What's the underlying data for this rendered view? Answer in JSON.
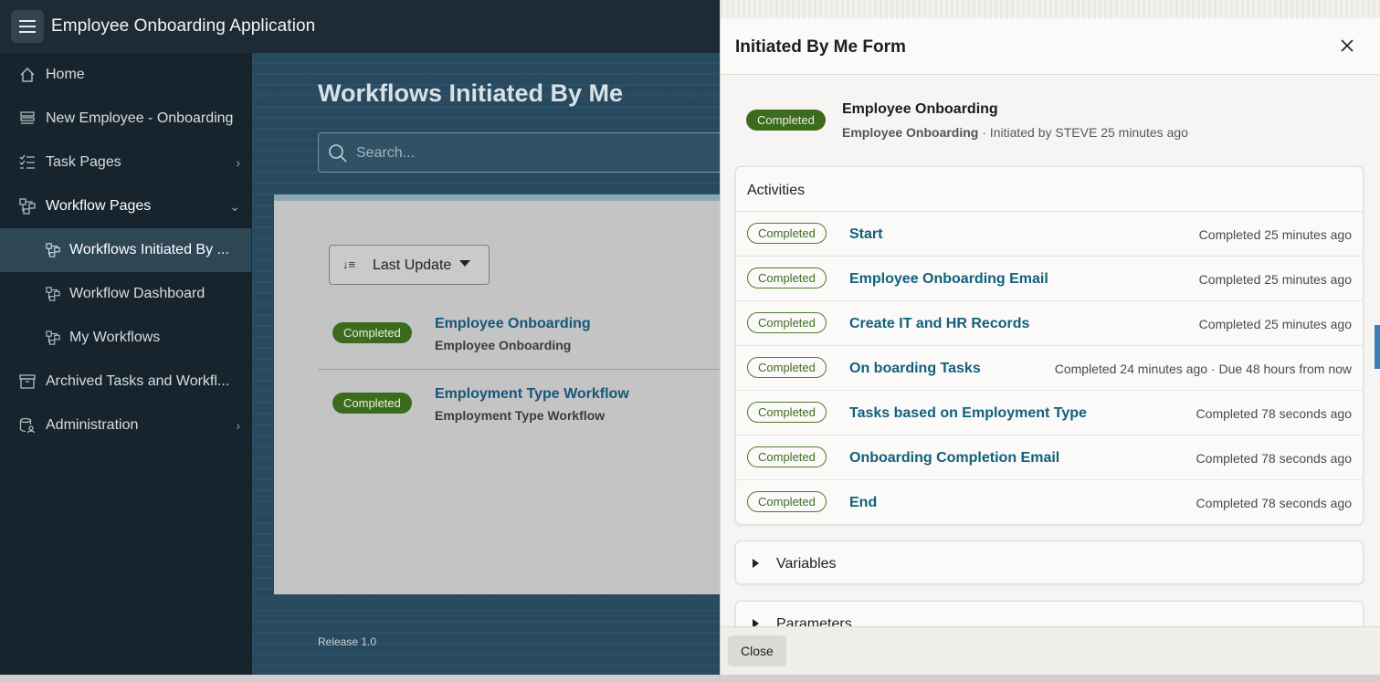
{
  "header": {
    "app_title": "Employee Onboarding Application"
  },
  "sidebar": {
    "items": [
      {
        "label": "Home",
        "icon": "home-icon"
      },
      {
        "label": "New Employee - Onboarding",
        "icon": "form-icon"
      },
      {
        "label": "Task Pages",
        "icon": "checklist-icon",
        "chevron": "›"
      },
      {
        "label": "Workflow Pages",
        "icon": "workflow-icon",
        "chevron": "⌄"
      },
      {
        "label": "Workflows Initiated By ...",
        "icon": "workflow-icon",
        "active": true
      },
      {
        "label": "Workflow Dashboard",
        "icon": "workflow-icon"
      },
      {
        "label": "My Workflows",
        "icon": "workflow-icon"
      },
      {
        "label": "Archived Tasks and Workfl...",
        "icon": "archive-icon"
      },
      {
        "label": "Administration",
        "icon": "admin-icon",
        "chevron": "›"
      }
    ]
  },
  "main": {
    "title": "Workflows Initiated By Me",
    "search_placeholder": "Search...",
    "sort_label": "Last Update",
    "workflows": [
      {
        "status": "Completed",
        "title": "Employee Onboarding",
        "subtitle": "Employee Onboarding"
      },
      {
        "status": "Completed",
        "title": "Employment Type Workflow",
        "subtitle": "Employment Type Workflow"
      }
    ],
    "release": "Release 1.0"
  },
  "drawer": {
    "title": "Initiated By Me Form",
    "summary": {
      "status": "Completed",
      "title": "Employee Onboarding",
      "subtitle_bold": "Employee Onboarding",
      "subtitle_rest": " · Initiated by STEVE 25 minutes ago"
    },
    "activities_label": "Activities",
    "activities": [
      {
        "status": "Completed",
        "name": "Start",
        "time": "Completed 25 minutes ago"
      },
      {
        "status": "Completed",
        "name": "Employee Onboarding Email",
        "time": "Completed 25 minutes ago"
      },
      {
        "status": "Completed",
        "name": "Create IT and HR Records",
        "time": "Completed 25 minutes ago"
      },
      {
        "status": "Completed",
        "name": "On boarding Tasks",
        "time": "Completed 24 minutes ago · Due 48 hours from now"
      },
      {
        "status": "Completed",
        "name": "Tasks based on Employment Type",
        "time": "Completed 78 seconds ago"
      },
      {
        "status": "Completed",
        "name": "Onboarding Completion Email",
        "time": "Completed 78 seconds ago"
      },
      {
        "status": "Completed",
        "name": "End",
        "time": "Completed 78 seconds ago"
      }
    ],
    "variables_label": "Variables",
    "parameters_label": "Parameters",
    "close_label": "Close"
  },
  "colors": {
    "sidebar_bg": "#17242d",
    "header_bg": "#1e2b34",
    "active_nav": "#2d4755",
    "completed_green": "#3d6b1e",
    "link_blue": "#11607e"
  }
}
